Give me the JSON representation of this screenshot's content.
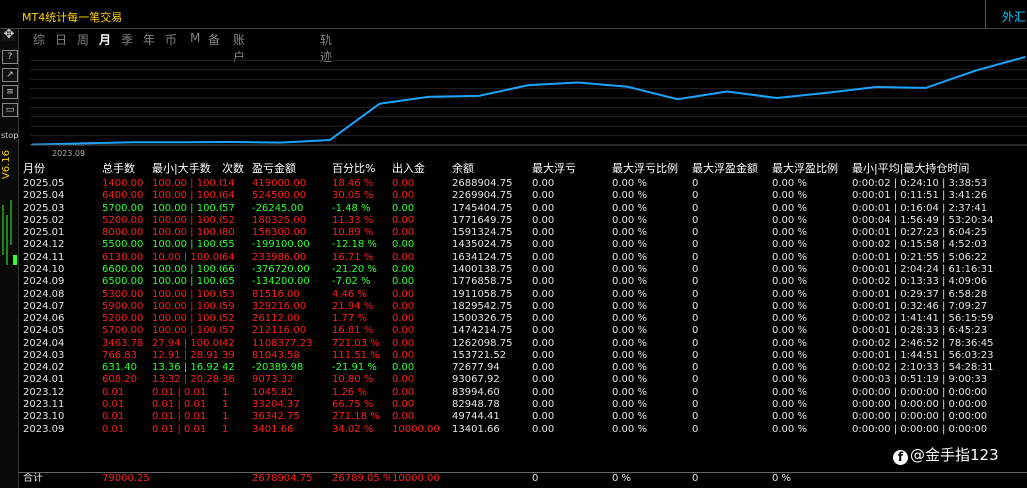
{
  "window": {
    "title": "MT4统计每一笔交易",
    "right_label": "外汇"
  },
  "toolbar": {
    "stop_label": "stop",
    "version_label": "V6.16"
  },
  "tabs": [
    "综",
    "日",
    "周",
    "月",
    "季",
    "年",
    "币",
    "M",
    "备",
    "账户",
    "轨迹"
  ],
  "active_tab": "月",
  "chart_data": {
    "type": "line",
    "x_label_shown": "2023.09",
    "x": [
      "2023.09",
      "2023.10",
      "2023.11",
      "2023.12",
      "2024.01",
      "2024.02",
      "2024.03",
      "2024.04",
      "2024.05",
      "2024.06",
      "2024.07",
      "2024.08",
      "2024.09",
      "2024.10",
      "2024.11",
      "2024.12",
      "2025.01",
      "2025.02",
      "2025.03",
      "2025.04",
      "2025.05"
    ],
    "values": [
      13401.66,
      49744.41,
      82948.78,
      83994.6,
      93067.92,
      72677.94,
      153721.52,
      1262098.75,
      1474214.75,
      1500326.75,
      1829542.75,
      1911058.75,
      1776858.75,
      1400138.75,
      1634124.75,
      1435024.75,
      1591324.75,
      1771649.75,
      1745404.75,
      2269904.75,
      2688904.75
    ],
    "color": "#1aa3ff",
    "grid": true
  },
  "table": {
    "headers": [
      "月份",
      "总手数",
      "最小|大手数",
      "次数",
      "盈亏金额",
      "百分比%",
      "出入金",
      "余额",
      "最大浮亏",
      "最大浮亏比例",
      "最大浮盈金额",
      "最大浮盈比例",
      "最小|平均|最大持仓时间"
    ],
    "rows": [
      {
        "c": "red",
        "v": [
          "2025.05",
          "1400.00",
          "100.00 | 100.00",
          "14",
          "419000.00",
          "18.46 %",
          "0.00",
          "2688904.75",
          "0.00",
          "0.00 %",
          "0",
          "0.00 %",
          "0:00:02 | 0:24:10 | 3:38:53"
        ]
      },
      {
        "c": "red",
        "v": [
          "2025.04",
          "6400.00",
          "100.00 | 100.00",
          "64",
          "524500.00",
          "30.05 %",
          "0.00",
          "2269904.75",
          "0.00",
          "0.00 %",
          "0",
          "0.00 %",
          "0:00:01 | 0:11:51 | 3:41:26"
        ]
      },
      {
        "c": "grn",
        "v": [
          "2025.03",
          "5700.00",
          "100.00 | 100.00",
          "57",
          "-26245.00",
          "-1.48 %",
          "0.00",
          "1745404.75",
          "0.00",
          "0.00 %",
          "0",
          "0.00 %",
          "0:00:01 | 0:16:04 | 2:37:41"
        ]
      },
      {
        "c": "red",
        "v": [
          "2025.02",
          "5200.00",
          "100.00 | 100.00",
          "52",
          "180325.00",
          "11.33 %",
          "0.00",
          "1771649.75",
          "0.00",
          "0.00 %",
          "0",
          "0.00 %",
          "0:00:04 | 1:56:49 | 53:20:34"
        ]
      },
      {
        "c": "red",
        "v": [
          "2025.01",
          "8000.00",
          "100.00 | 100.00",
          "80",
          "156300.00",
          "10.89 %",
          "0.00",
          "1591324.75",
          "0.00",
          "0.00 %",
          "0",
          "0.00 %",
          "0:00:01 | 0:27:23 | 6:04:25"
        ]
      },
      {
        "c": "grn",
        "v": [
          "2024.12",
          "5500.00",
          "100.00 | 100.00",
          "55",
          "-199100.00",
          "-12.18 %",
          "0.00",
          "1435024.75",
          "0.00",
          "0.00 %",
          "0",
          "0.00 %",
          "0:00:02 | 0:15:58 | 4:52:03"
        ]
      },
      {
        "c": "red",
        "v": [
          "2024.11",
          "6130.00",
          "10.00 | 100.00",
          "64",
          "233986.00",
          "16.71 %",
          "0.00",
          "1634124.75",
          "0.00",
          "0.00 %",
          "0",
          "0.00 %",
          "0:00:01 | 0:21:55 | 5:06:22"
        ]
      },
      {
        "c": "grn",
        "v": [
          "2024.10",
          "6600.00",
          "100.00 | 100.00",
          "66",
          "-376720.00",
          "-21.20 %",
          "0.00",
          "1400138.75",
          "0.00",
          "0.00 %",
          "0",
          "0.00 %",
          "0:00:01 | 2:04:24 | 61:16:31"
        ]
      },
      {
        "c": "grn",
        "v": [
          "2024.09",
          "6500.00",
          "100.00 | 100.00",
          "65",
          "-134200.00",
          "-7.02 %",
          "0.00",
          "1776858.75",
          "0.00",
          "0.00 %",
          "0",
          "0.00 %",
          "0:00:02 | 0:13:33 | 4:09:06"
        ]
      },
      {
        "c": "red",
        "v": [
          "2024.08",
          "5300.00",
          "100.00 | 100.00",
          "53",
          "81516.00",
          "4.46 %",
          "0.00",
          "1911058.75",
          "0.00",
          "0.00 %",
          "0",
          "0.00 %",
          "0:00:01 | 0:29:37 | 6:58:28"
        ]
      },
      {
        "c": "red",
        "v": [
          "2024.07",
          "5900.00",
          "100.00 | 100.00",
          "59",
          "329216.00",
          "21.94 %",
          "0.00",
          "1829542.75",
          "0.00",
          "0.00 %",
          "0",
          "0.00 %",
          "0:00:01 | 0:32:46 | 7:09:27"
        ]
      },
      {
        "c": "red",
        "v": [
          "2024.06",
          "5200.00",
          "100.00 | 100.00",
          "52",
          "26112.00",
          "1.77 %",
          "0.00",
          "1500326.75",
          "0.00",
          "0.00 %",
          "0",
          "0.00 %",
          "0:00:02 | 1:41:41 | 56:15:59"
        ]
      },
      {
        "c": "red",
        "v": [
          "2024.05",
          "5700.00",
          "100.00 | 100.00",
          "57",
          "212116.00",
          "16.81 %",
          "0.00",
          "1474214.75",
          "0.00",
          "0.00 %",
          "0",
          "0.00 %",
          "0:00:01 | 0:28:33 | 6:45:23"
        ]
      },
      {
        "c": "red",
        "v": [
          "2024.04",
          "3463.78",
          "27.94 | 100.00",
          "42",
          "1108377.23",
          "721.03 %",
          "0.00",
          "1262098.75",
          "0.00",
          "0.00 %",
          "0",
          "0.00 %",
          "0:00:02 | 2:46:52 | 78:36:45"
        ]
      },
      {
        "c": "red",
        "v": [
          "2024.03",
          "766.83",
          "12.91 | 28.91",
          "39",
          "81043.58",
          "111.51 %",
          "0.00",
          "153721.52",
          "0.00",
          "0.00 %",
          "0",
          "0.00 %",
          "0:00:01 | 1:44:51 | 56:03:23"
        ]
      },
      {
        "c": "grn",
        "v": [
          "2024.02",
          "631.40",
          "13.36 | 16.92",
          "42",
          "-20389.98",
          "-21.91 %",
          "0.00",
          "72677.94",
          "0.00",
          "0.00 %",
          "0",
          "0.00 %",
          "0:00:02 | 2:10:33 | 54:28:31"
        ]
      },
      {
        "c": "red",
        "v": [
          "2024.01",
          "608.20",
          "13.32 | 20.28",
          "36",
          "9073.32",
          "10.80 %",
          "0.00",
          "93067.92",
          "0.00",
          "0.00 %",
          "0",
          "0.00 %",
          "0:00:03 | 0:51:19 | 9:00:33"
        ]
      },
      {
        "c": "red",
        "v": [
          "2023.12",
          "0.01",
          "0.01 | 0.01",
          "1",
          "1045.82",
          "1.26 %",
          "0.00",
          "83994.60",
          "0.00",
          "0.00 %",
          "0",
          "0.00 %",
          "0:00:00 | 0:00:00 | 0:00:00"
        ]
      },
      {
        "c": "red",
        "v": [
          "2023.11",
          "0.01",
          "0.01 | 0.01",
          "1",
          "33204.37",
          "66.75 %",
          "0.00",
          "82948.78",
          "0.00",
          "0.00 %",
          "0",
          "0.00 %",
          "0:00:00 | 0:00:00 | 0:00:00"
        ]
      },
      {
        "c": "red",
        "v": [
          "2023.10",
          "0.01",
          "0.01 | 0.01",
          "1",
          "36342.75",
          "271.18 %",
          "0.00",
          "49744.41",
          "0.00",
          "0.00 %",
          "0",
          "0.00 %",
          "0:00:00 | 0:00:00 | 0:00:00"
        ]
      },
      {
        "c": "red",
        "v": [
          "2023.09",
          "0.01",
          "0.01 | 0.01",
          "1",
          "3401.66",
          "34.02 %",
          "10000.00",
          "13401.66",
          "0.00",
          "0.00 %",
          "0",
          "0.00 %",
          "0:00:00 | 0:00:00 | 0:00:00"
        ]
      }
    ],
    "total": {
      "c": "red",
      "v": [
        "合计",
        "79000.25",
        "",
        "",
        "2678904.75",
        "26789.05 %",
        "10000.00",
        "",
        "0",
        "0 %",
        "0",
        "0 %",
        ""
      ]
    }
  },
  "watermark": {
    "icon": "f",
    "text": "@金手指123"
  },
  "colors": {
    "profit": "#ff1e1e",
    "loss": "#2fff2f",
    "title": "#ffd200",
    "accent": "#00c8ff",
    "line": "#1aa3ff"
  }
}
